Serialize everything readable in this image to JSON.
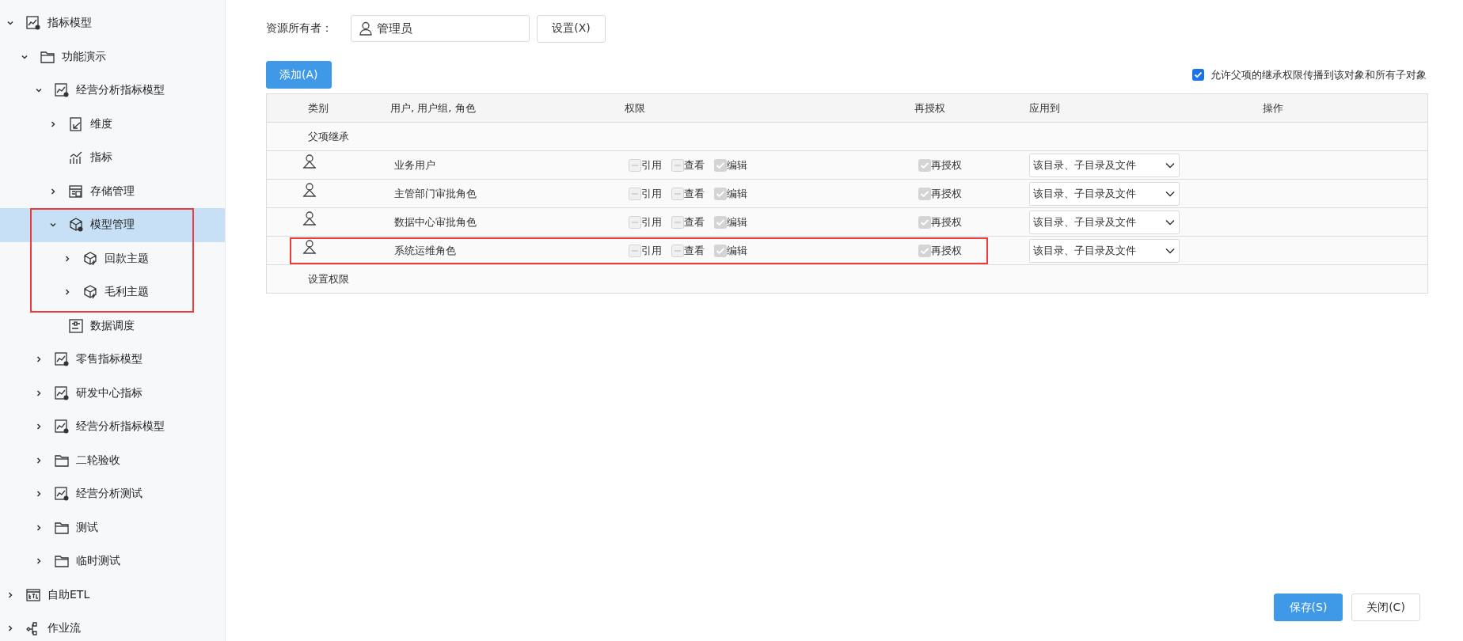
{
  "sidebar": {
    "tree": [
      {
        "label": "指标模型",
        "kind": "model",
        "expanded": true,
        "leaf": false,
        "selected": false,
        "highlighted": false,
        "children": [
          {
            "label": "功能演示",
            "kind": "folder",
            "expanded": true,
            "leaf": false,
            "selected": false,
            "highlighted": false,
            "children": [
              {
                "label": "经营分析指标模型",
                "kind": "model",
                "expanded": true,
                "leaf": false,
                "selected": false,
                "highlighted": false,
                "children": [
                  {
                    "label": "维度",
                    "kind": "dimension",
                    "expanded": false,
                    "leaf": false,
                    "selected": false,
                    "highlighted": false
                  },
                  {
                    "label": "指标",
                    "kind": "metric",
                    "leaf": true,
                    "selected": false,
                    "highlighted": false
                  },
                  {
                    "label": "存储管理",
                    "kind": "storage",
                    "expanded": false,
                    "leaf": false,
                    "selected": false,
                    "highlighted": false
                  },
                  {
                    "label": "模型管理",
                    "kind": "cube-gear",
                    "expanded": true,
                    "leaf": false,
                    "selected": true,
                    "highlighted": true,
                    "children": [
                      {
                        "label": "回款主题",
                        "kind": "cube",
                        "expanded": false,
                        "leaf": false,
                        "selected": false,
                        "highlighted": false
                      },
                      {
                        "label": "毛利主题",
                        "kind": "cube",
                        "expanded": false,
                        "leaf": false,
                        "selected": false,
                        "highlighted": false
                      }
                    ]
                  },
                  {
                    "label": "数据调度",
                    "kind": "schedule",
                    "leaf": true,
                    "selected": false,
                    "highlighted": false
                  }
                ]
              },
              {
                "label": "零售指标模型",
                "kind": "model",
                "expanded": false,
                "leaf": false,
                "selected": false,
                "highlighted": false
              },
              {
                "label": "研发中心指标",
                "kind": "model",
                "expanded": false,
                "leaf": false,
                "selected": false,
                "highlighted": false
              },
              {
                "label": "经营分析指标模型",
                "kind": "model",
                "expanded": false,
                "leaf": false,
                "selected": false,
                "highlighted": false
              },
              {
                "label": "二轮验收",
                "kind": "folder",
                "expanded": false,
                "leaf": false,
                "selected": false,
                "highlighted": false
              },
              {
                "label": "经营分析测试",
                "kind": "model",
                "expanded": false,
                "leaf": false,
                "selected": false,
                "highlighted": false
              },
              {
                "label": "测试",
                "kind": "folder",
                "expanded": false,
                "leaf": false,
                "selected": false,
                "highlighted": false
              },
              {
                "label": "临时测试",
                "kind": "folder",
                "expanded": false,
                "leaf": false,
                "selected": false,
                "highlighted": false
              }
            ]
          }
        ]
      },
      {
        "label": "自助ETL",
        "kind": "etl",
        "expanded": false,
        "leaf": false,
        "selected": false,
        "highlighted": false
      },
      {
        "label": "作业流",
        "kind": "flow",
        "expanded": false,
        "leaf": false,
        "selected": false,
        "highlighted": false
      }
    ]
  },
  "owner": {
    "label": "资源所有者：",
    "value": "管理员",
    "button": "设置(X)"
  },
  "add_button": "添加(A)",
  "propagate": {
    "label": "允许父项的继承权限传播到该对象和所有子对象",
    "checked": true
  },
  "table": {
    "columns": [
      "类别",
      "用户, 用户组, 角色",
      "权限",
      "再授权",
      "应用到",
      "操作"
    ],
    "rows": [
      {
        "kind": "section",
        "title": "父项继承"
      },
      {
        "kind": "entry",
        "name": "业务用户",
        "highlighted": false,
        "permissions": [
          {
            "label": "引用",
            "checked": false
          },
          {
            "label": "查看",
            "checked": false
          },
          {
            "label": "编辑",
            "checked": true
          }
        ],
        "regrant": {
          "label": "再授权",
          "checked": true
        },
        "apply_to": "该目录、子目录及文件"
      },
      {
        "kind": "entry",
        "name": "主管部门审批角色",
        "highlighted": false,
        "permissions": [
          {
            "label": "引用",
            "checked": false
          },
          {
            "label": "查看",
            "checked": false
          },
          {
            "label": "编辑",
            "checked": true
          }
        ],
        "regrant": {
          "label": "再授权",
          "checked": true
        },
        "apply_to": "该目录、子目录及文件"
      },
      {
        "kind": "entry",
        "name": "数据中心审批角色",
        "highlighted": false,
        "permissions": [
          {
            "label": "引用",
            "checked": false
          },
          {
            "label": "查看",
            "checked": false
          },
          {
            "label": "编辑",
            "checked": true
          }
        ],
        "regrant": {
          "label": "再授权",
          "checked": true
        },
        "apply_to": "该目录、子目录及文件"
      },
      {
        "kind": "entry",
        "name": "系统运维角色",
        "highlighted": true,
        "permissions": [
          {
            "label": "引用",
            "checked": false
          },
          {
            "label": "查看",
            "checked": false
          },
          {
            "label": "编辑",
            "checked": true
          }
        ],
        "regrant": {
          "label": "再授权",
          "checked": true
        },
        "apply_to": "该目录、子目录及文件"
      },
      {
        "kind": "section",
        "title": "设置权限"
      }
    ]
  },
  "footer": {
    "buttons": [
      {
        "label": "保存(S)",
        "primary": true
      },
      {
        "label": "关闭(C)",
        "primary": false
      }
    ]
  }
}
